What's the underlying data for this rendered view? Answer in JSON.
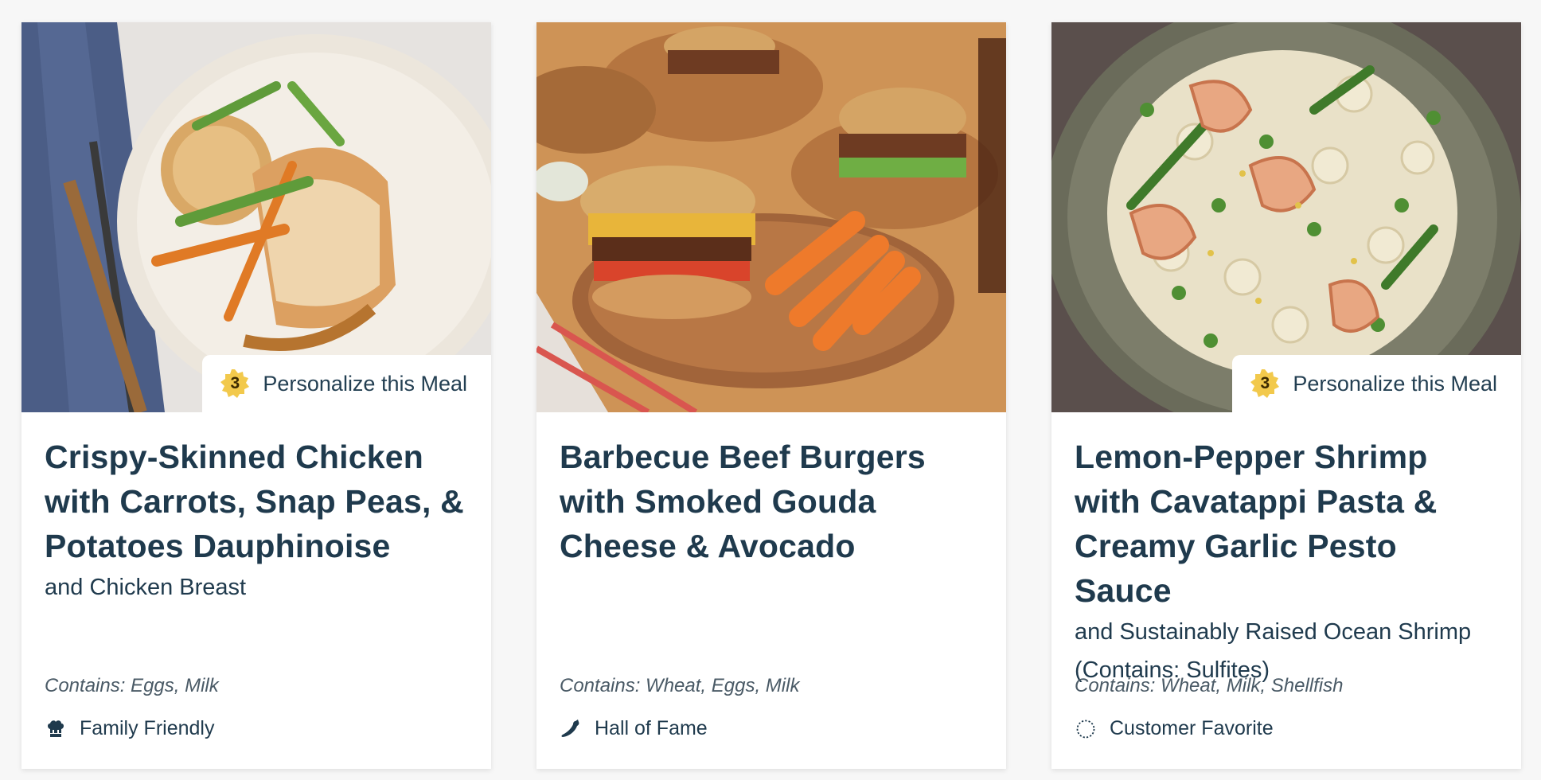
{
  "cards": [
    {
      "title": "Crispy-Skinned Chicken with Carrots, Snap Peas, & Potatoes Dauphinoise",
      "subtitle": "and Chicken Breast",
      "contains": "Contains: Eggs, Milk",
      "tag": "Family Friendly",
      "tag_icon": "chef-hat-icon",
      "badge": {
        "count": "3",
        "label": "Personalize this Meal"
      }
    },
    {
      "title": "Barbecue Beef Burgers with Smoked Gouda Cheese & Avocado",
      "subtitle": "",
      "contains": "Contains: Wheat, Eggs, Milk",
      "tag": "Hall of Fame",
      "tag_icon": "chili-pepper-icon"
    },
    {
      "title": "Lemon-Pepper Shrimp with Cavatappi Pasta & Creamy Garlic Pesto Sauce",
      "subtitle": "and Sustainably Raised Ocean Shrimp (Contains: Sulfites)",
      "contains": "Contains: Wheat, Milk, Shellfish",
      "tag": "Customer Favorite",
      "tag_icon": "dotted-circle-icon",
      "badge": {
        "count": "3",
        "label": "Personalize this Meal"
      }
    }
  ],
  "colors": {
    "title": "#1f3a4d",
    "badge_gold": "#f2c94c",
    "background": "#f7f7f7"
  }
}
